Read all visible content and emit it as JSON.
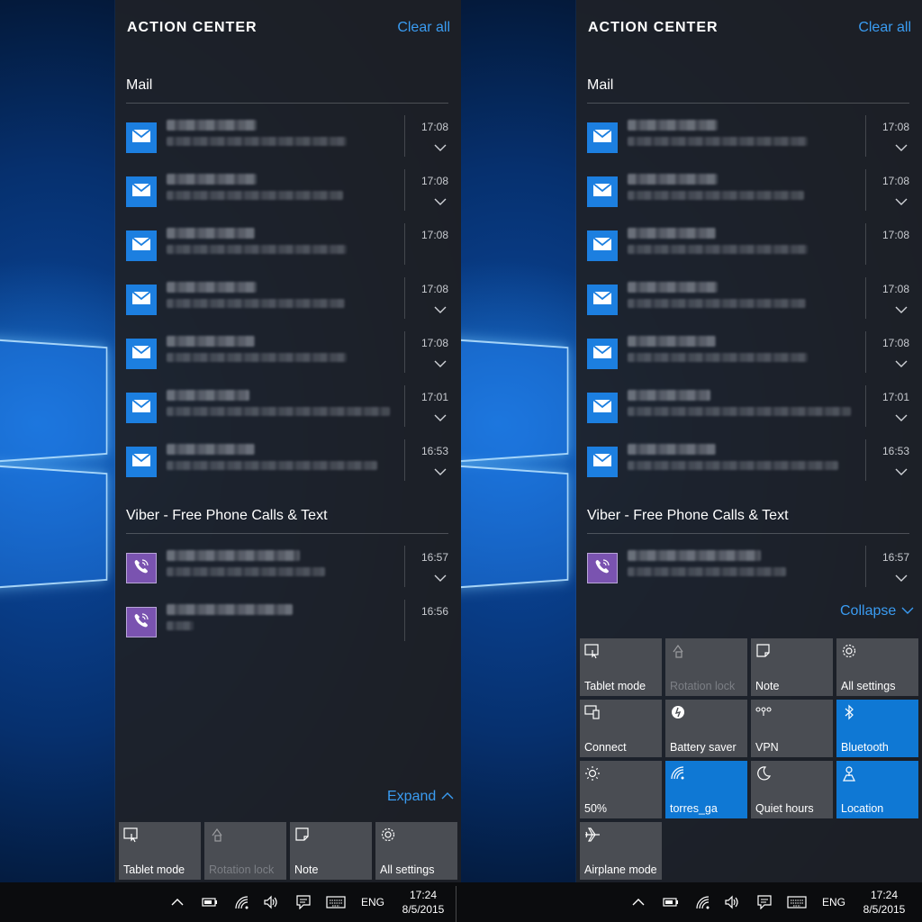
{
  "colors": {
    "accent": "#3a9cf2",
    "tile_on": "#0f78d4",
    "tile_off": "#4a4d53",
    "mail_icon": "#1c7fe0",
    "viber_icon": "#7a53b0"
  },
  "left": {
    "header": {
      "title": "ACTION CENTER",
      "clear_all": "Clear all"
    },
    "groups": {
      "mail": {
        "title": "Mail",
        "icon": "mail-icon",
        "items": [
          {
            "time": "17:08",
            "expandable": true
          },
          {
            "time": "17:08",
            "expandable": true
          },
          {
            "time": "17:08",
            "expandable": false
          },
          {
            "time": "17:08",
            "expandable": true
          },
          {
            "time": "17:08",
            "expandable": true
          },
          {
            "time": "17:01",
            "expandable": true
          },
          {
            "time": "16:53",
            "expandable": true
          }
        ]
      },
      "viber": {
        "title": "Viber - Free Phone Calls & Text",
        "icon": "viber-icon",
        "items": [
          {
            "time": "16:57",
            "expandable": true
          },
          {
            "time": "16:56",
            "expandable": false
          }
        ]
      }
    },
    "toggle": {
      "label": "Expand",
      "icon": "chevron-up-icon"
    },
    "quick_actions": [
      {
        "label": "Tablet mode",
        "icon": "tablet-mode-icon",
        "state": "off"
      },
      {
        "label": "Rotation lock",
        "icon": "rotation-lock-icon",
        "state": "disabled"
      },
      {
        "label": "Note",
        "icon": "note-icon",
        "state": "off"
      },
      {
        "label": "All settings",
        "icon": "gear-icon",
        "state": "off"
      }
    ]
  },
  "right": {
    "header": {
      "title": "ACTION CENTER",
      "clear_all": "Clear all"
    },
    "groups": {
      "mail": {
        "title": "Mail",
        "icon": "mail-icon",
        "items": [
          {
            "time": "17:08",
            "expandable": true
          },
          {
            "time": "17:08",
            "expandable": true
          },
          {
            "time": "17:08",
            "expandable": false
          },
          {
            "time": "17:08",
            "expandable": true
          },
          {
            "time": "17:08",
            "expandable": true
          },
          {
            "time": "17:01",
            "expandable": true
          },
          {
            "time": "16:53",
            "expandable": true
          }
        ]
      },
      "viber": {
        "title": "Viber - Free Phone Calls & Text",
        "icon": "viber-icon",
        "items": [
          {
            "time": "16:57",
            "expandable": true
          }
        ]
      }
    },
    "toggle": {
      "label": "Collapse",
      "icon": "chevron-down-icon"
    },
    "quick_actions": [
      {
        "label": "Tablet mode",
        "icon": "tablet-mode-icon",
        "state": "off"
      },
      {
        "label": "Rotation lock",
        "icon": "rotation-lock-icon",
        "state": "disabled"
      },
      {
        "label": "Note",
        "icon": "note-icon",
        "state": "off"
      },
      {
        "label": "All settings",
        "icon": "gear-icon",
        "state": "off"
      },
      {
        "label": "Connect",
        "icon": "connect-icon",
        "state": "off"
      },
      {
        "label": "Battery saver",
        "icon": "battery-saver-icon",
        "state": "off"
      },
      {
        "label": "VPN",
        "icon": "vpn-icon",
        "state": "off"
      },
      {
        "label": "Bluetooth",
        "icon": "bluetooth-icon",
        "state": "on"
      },
      {
        "label": "50%",
        "icon": "brightness-icon",
        "state": "off"
      },
      {
        "label": "torres_ga",
        "icon": "wifi-icon",
        "state": "on"
      },
      {
        "label": "Quiet hours",
        "icon": "moon-icon",
        "state": "off"
      },
      {
        "label": "Location",
        "icon": "location-icon",
        "state": "on"
      },
      {
        "label": "Airplane mode",
        "icon": "airplane-icon",
        "state": "off"
      }
    ]
  },
  "taskbar": {
    "language": "ENG",
    "time": "17:24",
    "date": "8/5/2015",
    "tray_icons": [
      "chevron-up-icon",
      "battery-icon",
      "wifi-icon",
      "volume-icon",
      "action-center-icon",
      "keyboard-icon"
    ]
  }
}
